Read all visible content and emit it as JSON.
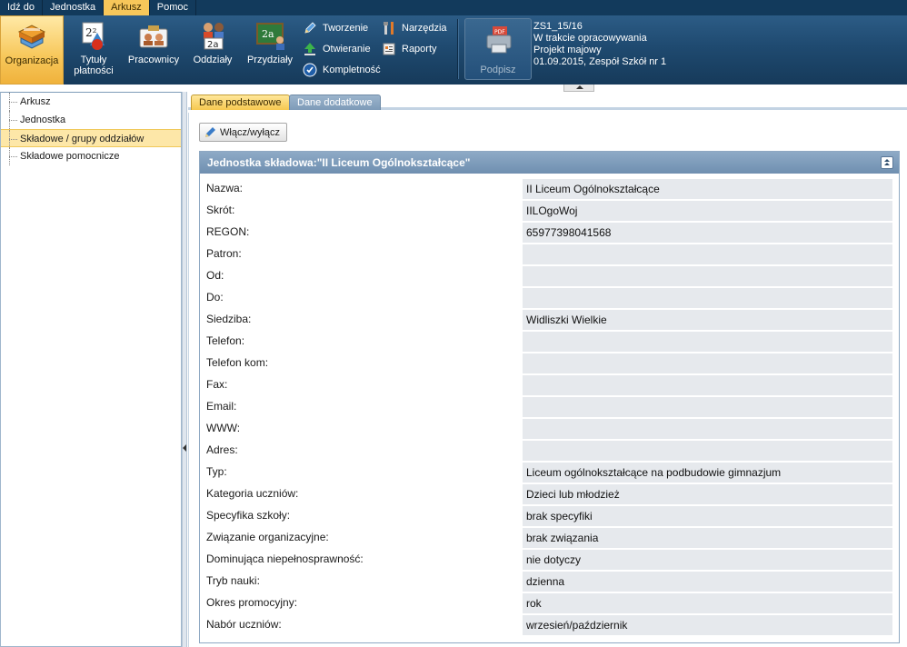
{
  "menu": {
    "items": [
      "Idź do",
      "Jednostka",
      "Arkusz",
      "Pomoc"
    ]
  },
  "ribbon": {
    "organizacja": "Organizacja",
    "tytuly_line1": "Tytuły",
    "tytuly_line2": "płatności",
    "pracownicy": "Pracownicy",
    "oddzialy": "Oddziały",
    "przydzialy": "Przydziały",
    "tworzenie": "Tworzenie",
    "otwieranie": "Otwieranie",
    "kompletnosc": "Kompletność",
    "narzedzia": "Narzędzia",
    "raporty": "Raporty",
    "podpisz": "Podpisz"
  },
  "info": {
    "line1": "ZS1_15/16",
    "line2": "W trakcie opracowywania",
    "line3": "Projekt majowy",
    "line4": "01.09.2015, Zespół Szkół nr 1"
  },
  "tree": {
    "items": [
      "Arkusz",
      "Jednostka",
      "Składowe / grupy oddziałów",
      "Składowe pomocnicze"
    ]
  },
  "tabs": {
    "basic": "Dane podstawowe",
    "extra": "Dane dodatkowe"
  },
  "toolbar": {
    "toggle_label": "Włącz/wyłącz"
  },
  "panel": {
    "title": "Jednostka składowa:\"II Liceum Ogólnokształcące\""
  },
  "fields": [
    {
      "label": "Nazwa:",
      "value": "II Liceum Ogólnokształcące"
    },
    {
      "label": "Skrót:",
      "value": "IILOgoWoj"
    },
    {
      "label": "REGON:",
      "value": "65977398041568"
    },
    {
      "label": "Patron:",
      "value": ""
    },
    {
      "label": "Od:",
      "value": ""
    },
    {
      "label": "Do:",
      "value": ""
    },
    {
      "label": "Siedziba:",
      "value": "Widliszki Wielkie"
    },
    {
      "label": "Telefon:",
      "value": ""
    },
    {
      "label": "Telefon kom:",
      "value": ""
    },
    {
      "label": "Fax:",
      "value": ""
    },
    {
      "label": "Email:",
      "value": ""
    },
    {
      "label": "WWW:",
      "value": ""
    },
    {
      "label": "Adres:",
      "value": ""
    },
    {
      "label": "Typ:",
      "value": "Liceum ogólnokształcące na podbudowie gimnazjum"
    },
    {
      "label": "Kategoria uczniów:",
      "value": "Dzieci lub młodzież"
    },
    {
      "label": "Specyfika szkoły:",
      "value": "brak specyfiki"
    },
    {
      "label": "Związanie organizacyjne:",
      "value": "brak związania"
    },
    {
      "label": "Dominująca niepełnosprawność:",
      "value": "nie dotyczy"
    },
    {
      "label": "Tryb nauki:",
      "value": "dzienna"
    },
    {
      "label": "Okres promocyjny:",
      "value": "rok"
    },
    {
      "label": "Nabór uczniów:",
      "value": "wrzesień/październik"
    }
  ]
}
